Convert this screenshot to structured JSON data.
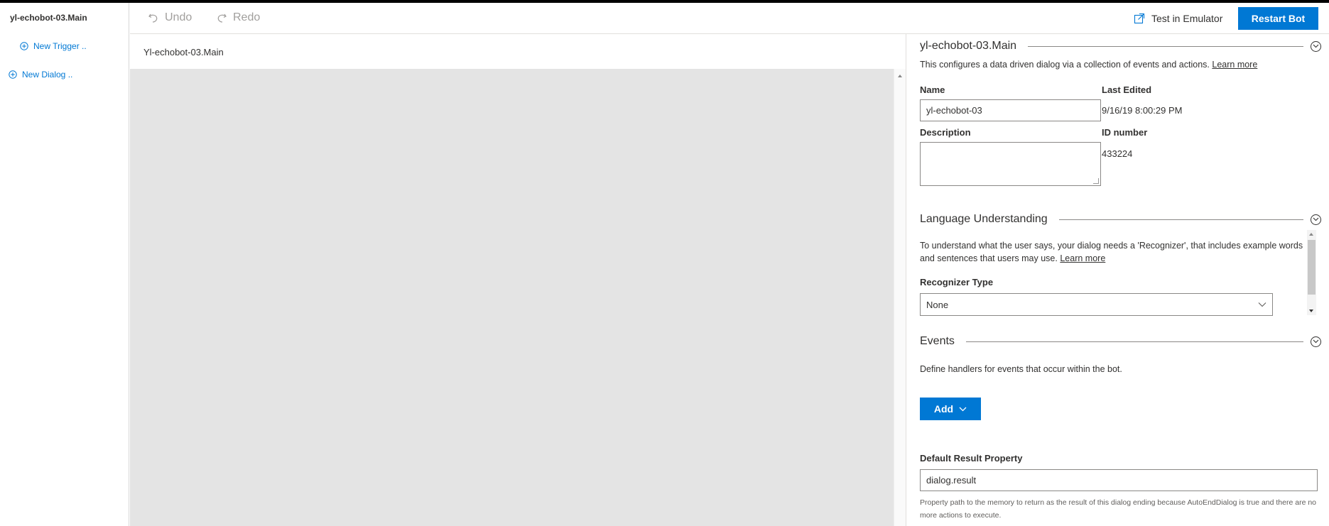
{
  "sidebar": {
    "title": "yl-echobot-03.Main",
    "new_trigger": "New Trigger ..",
    "new_dialog": "New Dialog .."
  },
  "toolbar": {
    "undo": "Undo",
    "redo": "Redo",
    "test_emulator": "Test in Emulator",
    "restart_bot": "Restart Bot"
  },
  "canvas": {
    "breadcrumb": "Yl-echobot-03.Main"
  },
  "panel": {
    "dialog": {
      "title": "yl-echobot-03.Main",
      "description": "This configures a data driven dialog via a collection of events and actions.",
      "learn_more": "Learn more"
    },
    "fields": {
      "name_label": "Name",
      "name_value": "yl-echobot-03",
      "last_edited_label": "Last Edited",
      "last_edited_value": "9/16/19 8:00:29 PM",
      "description_label": "Description",
      "description_value": "",
      "id_label": "ID number",
      "id_value": "433224"
    },
    "language": {
      "title": "Language Understanding",
      "description": "To understand what the user says, your dialog needs a 'Recognizer', that includes example words and sentences that users may use.",
      "learn_more": "Learn more",
      "recognizer_label": "Recognizer Type",
      "recognizer_value": "None"
    },
    "events": {
      "title": "Events",
      "description": "Define handlers for events that occur within the bot.",
      "add_button": "Add"
    },
    "result": {
      "label": "Default Result Property",
      "value": "dialog.result",
      "note": "Property path to the memory to return as the result of this dialog ending because AutoEndDialog is true and there are no more actions to execute."
    }
  },
  "colors": {
    "accent": "#0078d4",
    "canvas_bg": "#e4e4e4",
    "text": "#323130"
  },
  "icons": {
    "undo": "undo-icon",
    "redo": "redo-icon",
    "emulator": "open-external-icon",
    "add_circle": "add-circle-icon",
    "collapse": "chevron-circle-icon",
    "dropdown": "chevron-down-icon"
  }
}
